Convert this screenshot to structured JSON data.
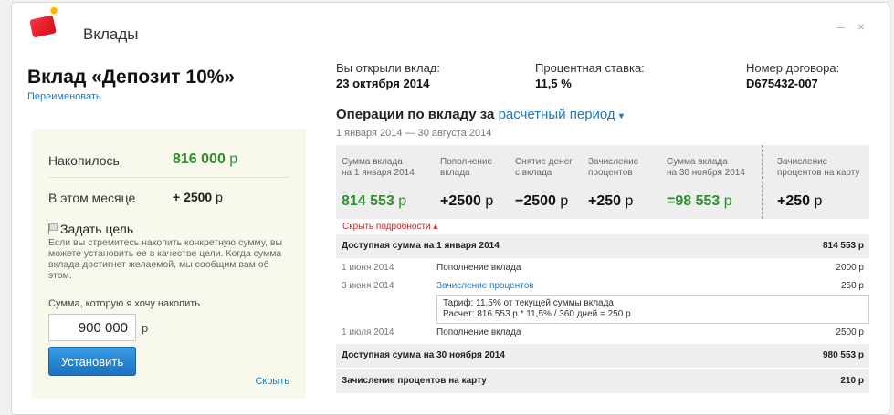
{
  "window": {
    "title": "Вклады",
    "controls": "–×"
  },
  "deposit": {
    "name": "Вклад «Депозит 10%»",
    "rename": "Переименовать"
  },
  "left": {
    "accumulated_label": "Накопилось",
    "accumulated_value": "816 000",
    "currency": "р",
    "month_label": "В этом месяце",
    "month_value": "+ 2500",
    "goal_title": "Задать цель",
    "goal_desc": "Если вы стремитесь накопить конкретную сумму, вы можете установить ее в качестве цели. Когда сумма вклада достигнет желаемой, мы сообщим вам об этом.",
    "amount_label": "Сумма, которую я хочу накопить",
    "amount_value": "900 000",
    "set_button": "Установить",
    "hide_link": "Скрыть"
  },
  "info": {
    "opened_label": "Вы открыли вклад:",
    "opened_value": "23 октября 2014",
    "rate_label": "Процентная ставка:",
    "rate_value": "11,5 %",
    "contract_label": "Номер договора:",
    "contract_value": "D675432-007"
  },
  "operations": {
    "title": "Операции по вкладу за",
    "period": "расчетный период",
    "caret": "▾",
    "dates": "1 января 2014 — 30 августа 2014",
    "summary": [
      {
        "h1": "Сумма вклада",
        "h2": "на 1 января 2014",
        "value": "814 553",
        "cur": "р"
      },
      {
        "h1": "Пополнение",
        "h2": "вклада",
        "value": "+2500",
        "cur": "р"
      },
      {
        "h1": "Снятие денег",
        "h2": "с вклада",
        "value": "−2500",
        "cur": "р"
      },
      {
        "h1": "Зачисление",
        "h2": "процентов",
        "value": "+250",
        "cur": "р"
      },
      {
        "h1": "Сумма вклада",
        "h2": "на 30 ноября 2014",
        "value": "=98 553",
        "cur": "р"
      },
      {
        "h1": "Зачисление",
        "h2": "процентов на карту",
        "value": "+250",
        "cur": "р"
      }
    ],
    "toggle": "Скрыть подробности ▴",
    "available_start_label": "Доступная сумма на 1 января 2014",
    "available_start_value": "814 553 р",
    "rows": [
      {
        "date": "1 июня 2014",
        "desc": "Пополнение вклада",
        "amount": "2000 р"
      },
      {
        "date": "3 июня 2014",
        "desc": "Зачисление процентов",
        "amount": "250 р"
      },
      {
        "date": "1 июля 2014",
        "desc": "Пополнение вклада",
        "amount": "2500 р"
      }
    ],
    "tip_line1": "Тариф: 11,5% от текущей суммы вклада",
    "tip_line2": "Расчет: 816 553 р * 11,5% / 360 дней = 250 р",
    "available_end_label": "Доступная сумма на 30 ноября 2014",
    "available_end_value": "980 553 р",
    "card_label": "Зачисление процентов на карту",
    "card_value": "210 р"
  }
}
